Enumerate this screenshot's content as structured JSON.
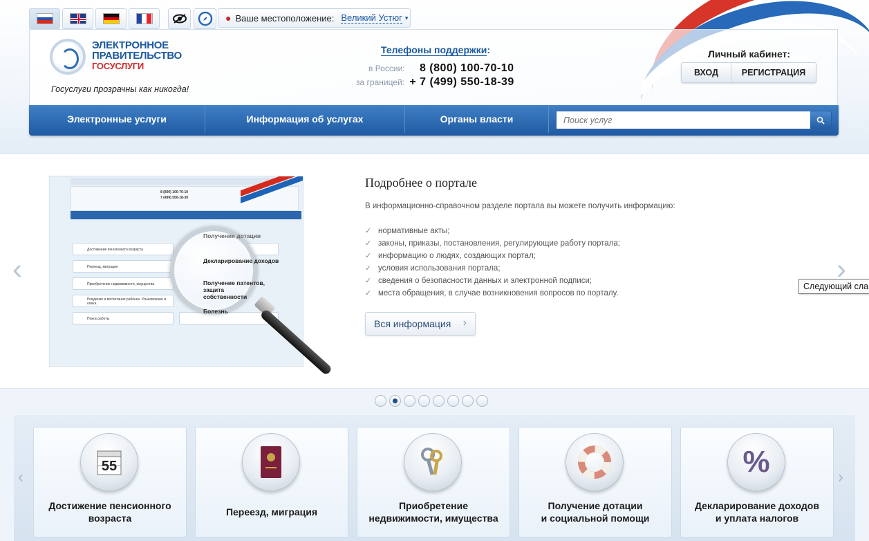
{
  "languages": [
    {
      "code": "ru",
      "active": true
    },
    {
      "code": "en",
      "active": false
    },
    {
      "code": "de",
      "active": false
    },
    {
      "code": "fr",
      "active": false
    }
  ],
  "location": {
    "label": "Ваше местоположение:",
    "city": "Великий Устюг"
  },
  "logo": {
    "line1": "ЭЛЕКТРОННОЕ",
    "line2": "ПРАВИТЕЛЬСТВО",
    "line3": "ГОСУСЛУГИ",
    "slogan": "Госуслуги прозрачны как никогда!"
  },
  "support": {
    "title": "Телефоны поддержки",
    "colon": ":",
    "russia_label": "в России:",
    "russia_phone": "8 (800) 100-70-10",
    "abroad_label": "за границей:",
    "abroad_phone": "+ 7 (499) 550-18-39"
  },
  "cabinet": {
    "title": "Личный кабинет:",
    "login": "ВХОД",
    "register": "РЕГИСТРАЦИЯ"
  },
  "nav": {
    "items": [
      "Электронные услуги",
      "Информация об услугах",
      "Органы власти"
    ],
    "search_placeholder": "Поиск услуг"
  },
  "slide": {
    "title": "Подробнее о портале",
    "intro": "В информационно-справочном разделе портала вы можете получить информацию:",
    "items": [
      "нормативные акты;",
      "законы, приказы, постановления, регулирующие работу портала;",
      "информацию о людях, создающих портал;",
      "условия использования портала;",
      "сведения о безопасности данных и электронной подписи;",
      "места обращения, в случае возникновения вопросов по порталу."
    ],
    "button": "Вся информация",
    "tooltip": "Следующий слайд",
    "image": {
      "phone1": "8 (800) 100-70-10",
      "phone2": "7 (499) 550-18-39",
      "lens_item1": "Получение дотации",
      "lens_item2": "Декларирование доходов",
      "lens_item3": "Получение патентов, защита собственности",
      "lens_item4": "Болезнь",
      "row1": "Достижение пенсионного возраста",
      "row2": "Переезд, миграция",
      "row3": "Приобретение недвижимости, имущества",
      "row4": "Рождение и воспитание ребёнка. Усыновление и опека.",
      "row5": "Поиск работы"
    }
  },
  "dots": {
    "count": 8,
    "active_index": 1
  },
  "categories": [
    {
      "label_line1": "Достижение пенсионного",
      "label_line2": "возраста",
      "icon": "calendar-55-icon"
    },
    {
      "label_line1": "Переезд, миграция",
      "label_line2": "",
      "icon": "passport-icon"
    },
    {
      "label_line1": "Приобретение",
      "label_line2": "недвижимости, имущества",
      "icon": "keys-icon"
    },
    {
      "label_line1": "Получение дотации",
      "label_line2": "и социальной помощи",
      "icon": "lifebuoy-icon"
    },
    {
      "label_line1": "Декларирование доходов",
      "label_line2": "и уплата налогов",
      "icon": "percent-icon"
    }
  ],
  "calendar_number": "55",
  "colors": {
    "nav": "#1f5aa2",
    "brand_blue": "#1d5a9e",
    "brand_red": "#d12c2c"
  }
}
